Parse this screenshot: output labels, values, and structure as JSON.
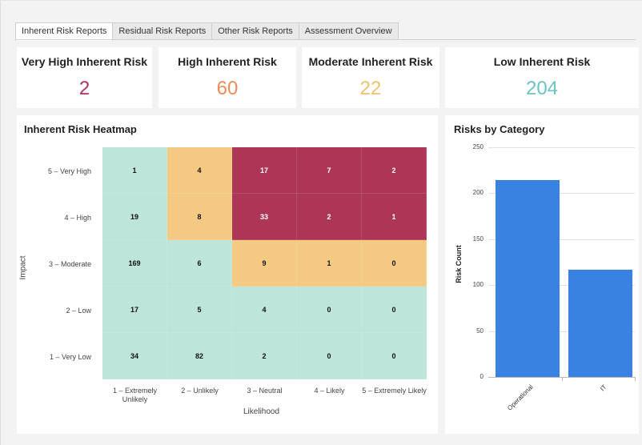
{
  "tabs": [
    {
      "label": "Inherent Risk Reports",
      "active": true
    },
    {
      "label": "Residual Risk Reports",
      "active": false
    },
    {
      "label": "Other Risk Reports",
      "active": false
    },
    {
      "label": "Assessment Overview",
      "active": false
    }
  ],
  "kpis": [
    {
      "title": "Very High Inherent Risk",
      "value": "2",
      "color": "#b0325a"
    },
    {
      "title": "High Inherent Risk",
      "value": "60",
      "color": "#ee8a5c"
    },
    {
      "title": "Moderate Inherent Risk",
      "value": "22",
      "color": "#f2c06e"
    },
    {
      "title": "Low Inherent Risk",
      "value": "204",
      "color": "#6bc4c2"
    }
  ],
  "heatmap": {
    "title": "Inherent Risk Heatmap",
    "y_axis_title": "Impact",
    "x_axis_title": "Likelihood",
    "rows": [
      "5 – Very High",
      "4 – High",
      "3 – Moderate",
      "2 – Low",
      "1 – Very Low"
    ],
    "cols": [
      "1 – Extremely Unlikely",
      "2 – Unlikely",
      "3 – Neutral",
      "4 – Likely",
      "5 – Extremely Likely"
    ],
    "values": [
      [
        1,
        4,
        17,
        7,
        2
      ],
      [
        19,
        8,
        33,
        2,
        1
      ],
      [
        169,
        6,
        9,
        1,
        0
      ],
      [
        17,
        5,
        4,
        0,
        0
      ],
      [
        34,
        82,
        2,
        0,
        0
      ]
    ],
    "levels": [
      [
        "low",
        "moderate",
        "veryhigh",
        "veryhigh",
        "veryhigh"
      ],
      [
        "low",
        "moderate",
        "veryhigh",
        "veryhigh",
        "veryhigh"
      ],
      [
        "low",
        "low",
        "moderate",
        "moderate",
        "moderate"
      ],
      [
        "low",
        "low",
        "low",
        "low",
        "low"
      ],
      [
        "low",
        "low",
        "low",
        "low",
        "low"
      ]
    ],
    "colors": {
      "low": "#bde5da",
      "moderate": "#f4ca82",
      "veryhigh": "#ad3656"
    }
  },
  "chart_data": {
    "type": "bar",
    "title": "Risks by Category",
    "categories": [
      "Operational",
      "IT"
    ],
    "values": [
      214,
      117
    ],
    "ylabel": "Risk Count",
    "xlabel": "",
    "ylim": [
      0,
      250
    ],
    "yticks": [
      0,
      50,
      100,
      150,
      200,
      250
    ],
    "color": "#3a82e1",
    "grid": true
  }
}
